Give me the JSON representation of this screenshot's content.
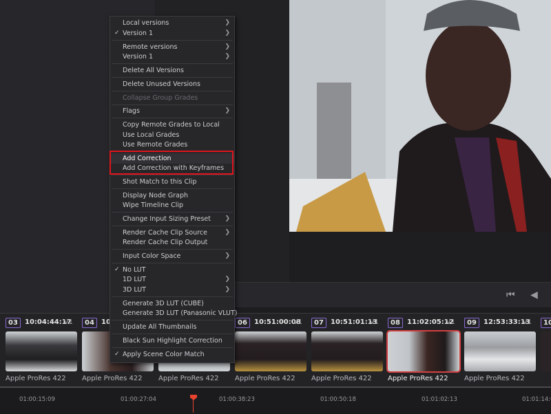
{
  "menu": {
    "local_versions": "Local versions",
    "local_version_1": "Version 1",
    "remote_versions": "Remote versions",
    "remote_version_1": "Version 1",
    "delete_all_versions": "Delete All Versions",
    "delete_unused_versions": "Delete Unused Versions",
    "collapse_group_grades": "Collapse Group Grades",
    "flags": "Flags",
    "copy_remote_grades": "Copy Remote Grades to Local",
    "use_local_grades": "Use Local Grades",
    "use_remote_grades": "Use Remote Grades",
    "add_correction": "Add Correction",
    "add_correction_keyframes": "Add Correction with Keyframes",
    "shot_match": "Shot Match to this Clip",
    "display_node_graph": "Display Node Graph",
    "wipe_timeline_clip": "Wipe Timeline Clip",
    "change_input_sizing": "Change Input Sizing Preset",
    "render_cache_clip_source": "Render Cache Clip Source",
    "render_cache_clip_output": "Render Cache Clip Output",
    "input_color_space": "Input Color Space",
    "no_lut": "No LUT",
    "lut_1d": "1D LUT",
    "lut_3d": "3D LUT",
    "generate_3d_lut_cube": "Generate 3D LUT (CUBE)",
    "generate_3d_lut_panasonic": "Generate 3D LUT (Panasonic VLUT)",
    "update_all_thumbnails": "Update All Thumbnails",
    "black_sun_highlight": "Black Sun Highlight Correction",
    "apply_scene_color_match": "Apply Scene Color Match"
  },
  "transport": {
    "first_frame_icon": "⏮",
    "prev_frame_icon": "◀"
  },
  "clips": [
    {
      "num": "03",
      "tc": "10:04:44:17",
      "track": "V1",
      "name": "Apple ProRes 422"
    },
    {
      "num": "04",
      "tc": "10",
      "track": "",
      "name": "Apple ProRes 422"
    },
    {
      "num": "05",
      "tc": "",
      "track": "",
      "name": "Apple ProRes 422"
    },
    {
      "num": "06",
      "tc": "10:51:00:08",
      "track": "V1",
      "name": "Apple ProRes 422"
    },
    {
      "num": "07",
      "tc": "10:51:01:13",
      "track": "V1",
      "name": "Apple ProRes 422"
    },
    {
      "num": "08",
      "tc": "11:02:05:12",
      "track": "V1",
      "name": "Apple ProRes 422"
    },
    {
      "num": "09",
      "tc": "12:53:33:13",
      "track": "V1",
      "name": "Apple ProRes 422"
    },
    {
      "num": "10",
      "tc": "",
      "track": "",
      "name": ""
    }
  ],
  "timeline": {
    "ticks": [
      "01:00:15:09",
      "01:00:27:04",
      "01:00:38:23",
      "01:00:50:18",
      "01:01:02:13",
      "01:01:14:0"
    ]
  },
  "colors": {
    "accent_red": "#e0141c",
    "playhead": "#e8432f",
    "selected_clip_border": "#d24040"
  }
}
